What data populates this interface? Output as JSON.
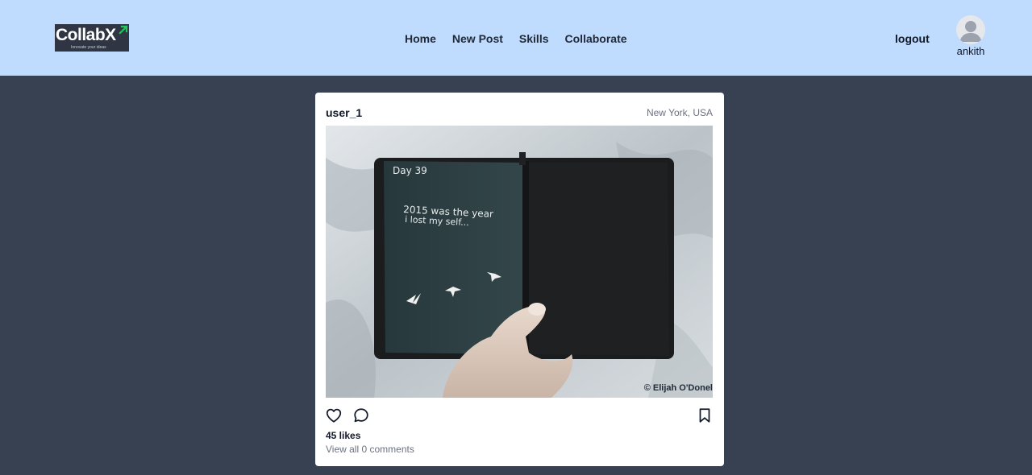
{
  "brand": {
    "name": "CollabX",
    "tagline": "Innovate your ideas",
    "accent": "#22c55e"
  },
  "nav": {
    "items": [
      "Home",
      "New Post",
      "Skills",
      "Collaborate"
    ]
  },
  "account": {
    "logout_label": "logout",
    "username": "ankith",
    "avatar_icon": "user-avatar-icon"
  },
  "post": {
    "author": "user_1",
    "location": "New York, USA",
    "image_credit": "© Elijah O'Donel",
    "likes_text": "45 likes",
    "comments_text": "View all 0 comments",
    "icons": {
      "like": "heart-icon",
      "comment": "comment-icon",
      "save": "bookmark-icon"
    },
    "image_text": {
      "day": "Day 39",
      "line1": "2015 was the year",
      "line2": "i lost  my self..."
    }
  },
  "colors": {
    "header_bg": "#bfdbfe",
    "page_bg": "#374151",
    "card_bg": "#ffffff"
  }
}
